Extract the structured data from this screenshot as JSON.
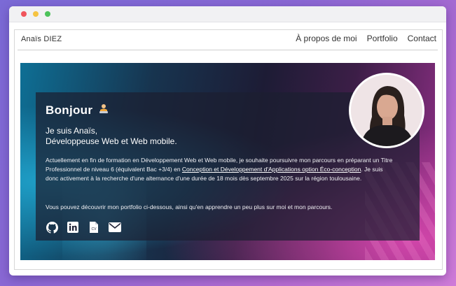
{
  "window": {
    "controls": [
      "close",
      "minimize",
      "maximize"
    ]
  },
  "nav": {
    "brand": "Anaïs DIEZ",
    "links": [
      {
        "label": "À propos de moi"
      },
      {
        "label": "Portfolio"
      },
      {
        "label": "Contact"
      }
    ]
  },
  "hero": {
    "greeting": "Bonjour",
    "greeting_icon": "laptop-person-icon",
    "intro_line1": "Je suis Anaïs,",
    "intro_line2": "Développeuse Web et Web mobile.",
    "paragraph1_before": "Actuellement en fin de formation en Développement Web et Web mobile, je souhaite poursuivre mon parcours en préparant un Titre Professionnel de niveau 6 (équivalent Bac +3/4) en ",
    "paragraph1_link": "Conception et Développement d'Applications option Éco-conception",
    "paragraph1_after": ". Je suis donc activement à la recherche d'une alternance d'une durée de 18 mois dès septembre 2025 sur la région toulousaine.",
    "paragraph2": "Vous pouvez découvrir mon portfolio ci-dessous, ainsi qu'en apprendre un peu plus sur moi et mon parcours.",
    "socials": [
      {
        "name": "github-icon"
      },
      {
        "name": "linkedin-icon"
      },
      {
        "name": "cv-document-icon"
      },
      {
        "name": "email-icon"
      }
    ]
  },
  "colors": {
    "window_bg": "#ffffff",
    "hero_teal": "#0e6f95",
    "hero_magenta": "#d045a9",
    "card_bg": "#1c1e30"
  }
}
